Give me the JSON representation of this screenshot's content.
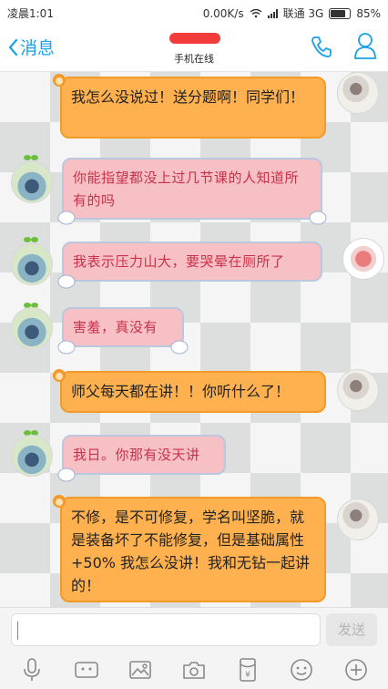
{
  "status": {
    "time": "凌晨1:01",
    "speed": "0.00K/s",
    "carrier": "联通 3G",
    "battery": "85%"
  },
  "header": {
    "back_label": "消息",
    "subtitle": "手机在线",
    "icons": [
      "chevron-left-icon",
      "phone-icon",
      "contact-icon"
    ],
    "accent": "#1aa1e6"
  },
  "messages": [
    {
      "side": "out",
      "text": "我怎么没说过！送分题啊！同学们！"
    },
    {
      "side": "in",
      "text": "你能指望都没上过几节课的人知道所有的吗"
    },
    {
      "side": "in",
      "text": "我表示压力山大，要哭晕在厕所了"
    },
    {
      "side": "in",
      "text": "害羞，真没有"
    },
    {
      "side": "out",
      "text": "师父每天都在讲！！你听什么了！"
    },
    {
      "side": "in",
      "text": "我日。你那有没天讲"
    },
    {
      "side": "out",
      "text": "不修，是不可修复，学名叫坚脆，就是装备坏了不能修复，但是基础属性+50% 我怎么没讲！我和无钻一起讲的！"
    }
  ],
  "composer": {
    "input_value": "",
    "send_label": "发送",
    "tools": [
      "mic-icon",
      "video-icon",
      "image-icon",
      "camera-icon",
      "red-packet-icon",
      "emoji-icon",
      "plus-icon"
    ]
  },
  "colors": {
    "outgoing_bubble": "#ffb14f",
    "incoming_bubble": "#f7c0c4",
    "incoming_text": "#c8314a"
  }
}
